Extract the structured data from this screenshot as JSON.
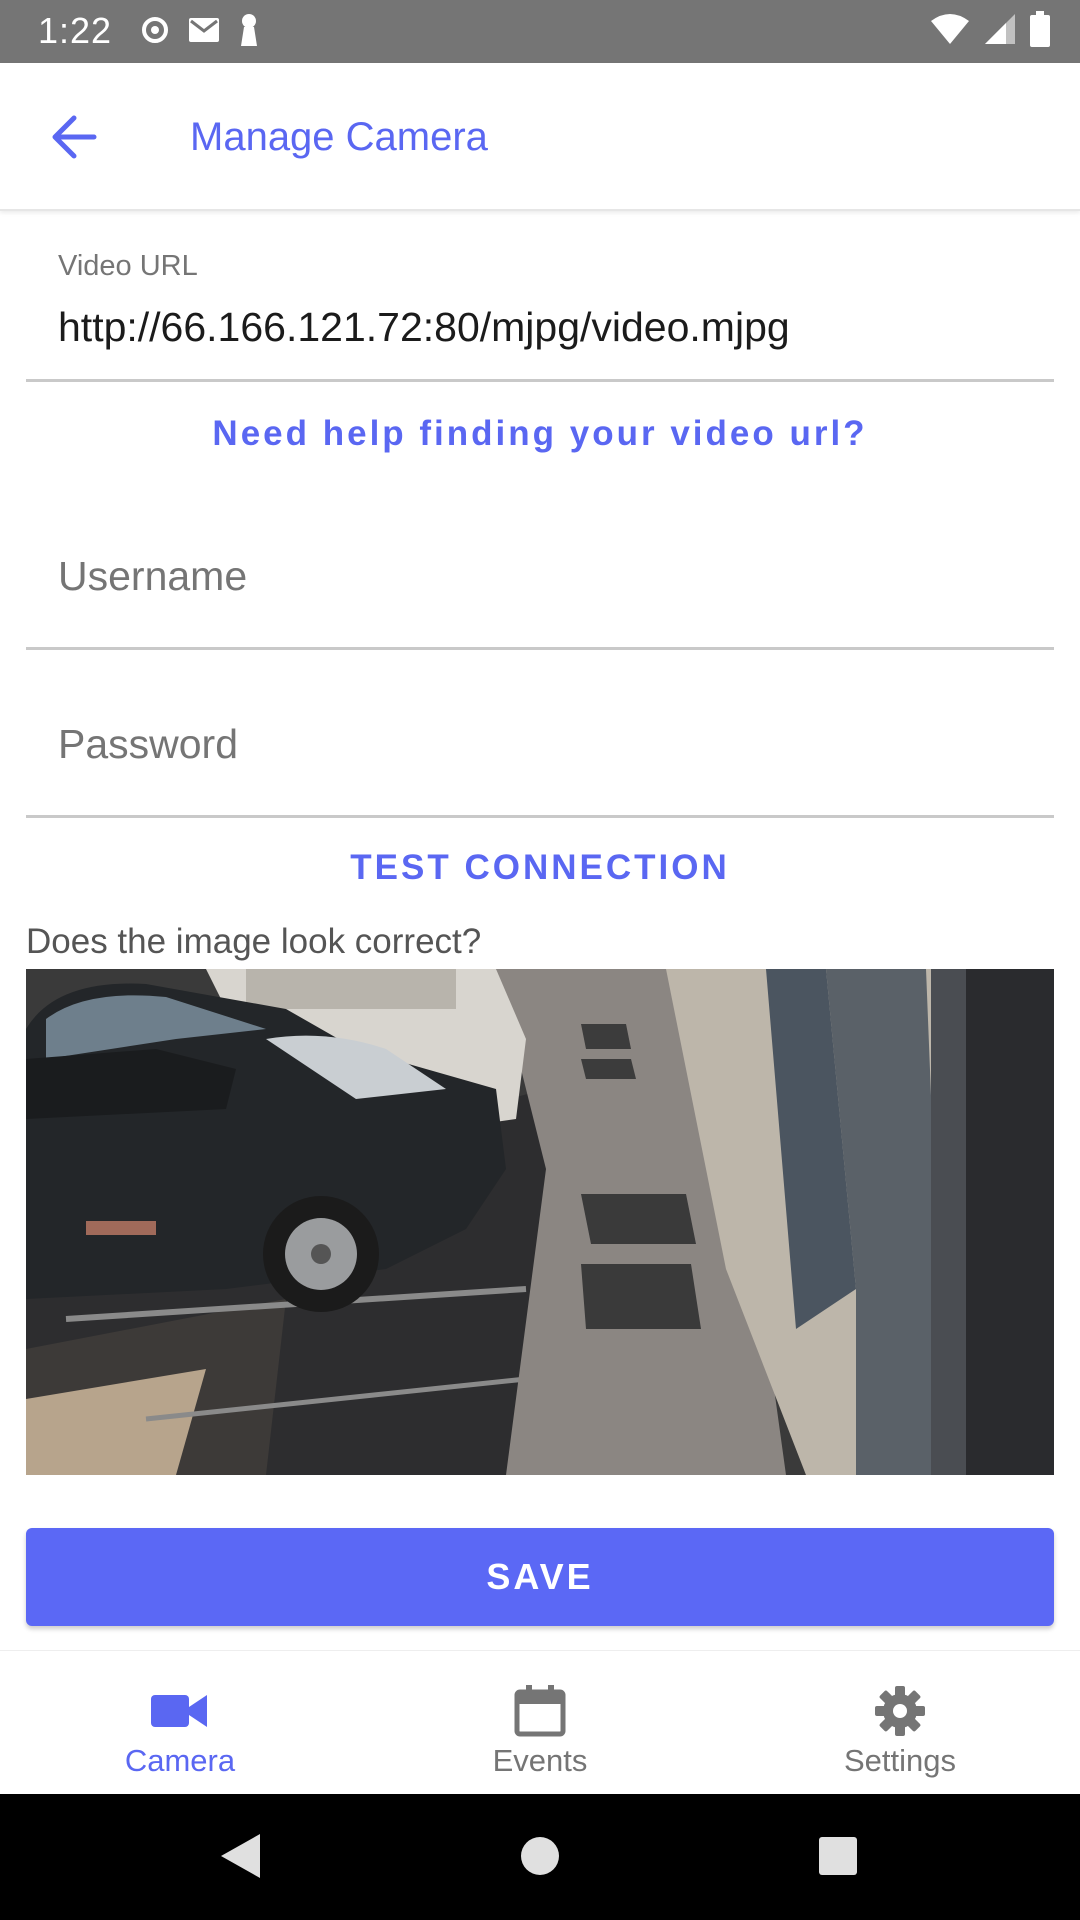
{
  "status_bar": {
    "time": "1:22",
    "left_icons": [
      "sync-icon",
      "gmail-icon",
      "keyhole-icon"
    ],
    "right_icons": [
      "wifi-icon",
      "cellular-icon",
      "battery-icon"
    ]
  },
  "app_bar": {
    "title": "Manage Camera",
    "back_icon": "arrow-back-icon"
  },
  "form": {
    "video_url": {
      "label": "Video URL",
      "value": "http://66.166.121.72:80/mjpg/video.mjpg"
    },
    "help_link": "Need help finding your video url?",
    "username": {
      "placeholder": "Username",
      "value": ""
    },
    "password": {
      "placeholder": "Password",
      "value": ""
    },
    "test_connection": "TEST CONNECTION",
    "question": "Does the image look correct?",
    "save": "SAVE"
  },
  "bottom_nav": {
    "items": [
      {
        "label": "Camera",
        "icon": "videocam-icon",
        "active": true
      },
      {
        "label": "Events",
        "icon": "calendar-icon",
        "active": false
      },
      {
        "label": "Settings",
        "icon": "gear-icon",
        "active": false
      }
    ]
  },
  "colors": {
    "accent": "#5a67f2",
    "save_button": "#5b68f5",
    "status_bar": "#757575",
    "system_nav": "#000000"
  }
}
